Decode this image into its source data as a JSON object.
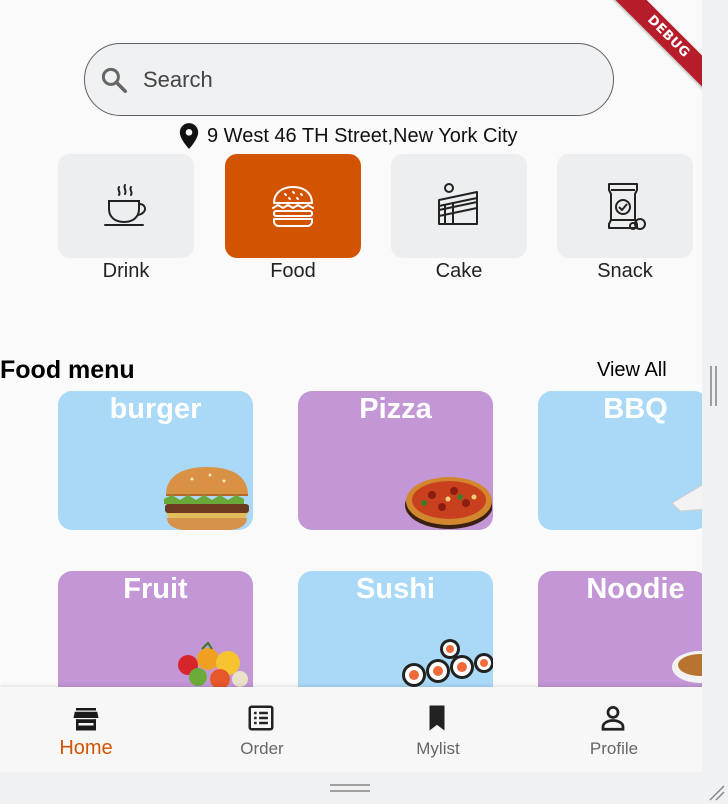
{
  "search": {
    "placeholder": "Search",
    "icon": "search-icon"
  },
  "location": {
    "icon": "location-pin-icon",
    "text": "9 West 46 TH Street,New York City"
  },
  "debug_banner": "DEBUG",
  "categories": [
    {
      "label": "Drink",
      "icon": "coffee-cup-icon",
      "active": false
    },
    {
      "label": "Food",
      "icon": "burger-icon",
      "active": true
    },
    {
      "label": "Cake",
      "icon": "cake-icon",
      "active": false
    },
    {
      "label": "Snack",
      "icon": "snack-bag-icon",
      "active": false
    }
  ],
  "section": {
    "title": "Food menu",
    "view_all": "View All"
  },
  "menu": [
    {
      "name": "burger",
      "color": "#a9d9f7"
    },
    {
      "name": "Pizza",
      "color": "#c397d6"
    },
    {
      "name": "BBQ",
      "color": "#a9d9f7"
    },
    {
      "name": "Fruit",
      "color": "#c397d6"
    },
    {
      "name": "Sushi",
      "color": "#a9d9f7"
    },
    {
      "name": "Noodie",
      "color": "#c397d6"
    }
  ],
  "nav": [
    {
      "label": "Home",
      "icon": "store-icon",
      "active": true
    },
    {
      "label": "Order",
      "icon": "order-list-icon",
      "active": false
    },
    {
      "label": "Mylist",
      "icon": "bookmark-icon",
      "active": false
    },
    {
      "label": "Profile",
      "icon": "person-icon",
      "active": false
    }
  ],
  "colors": {
    "accent": "#d35400",
    "blue_card": "#a9d9f7",
    "purple_card": "#c397d6"
  }
}
